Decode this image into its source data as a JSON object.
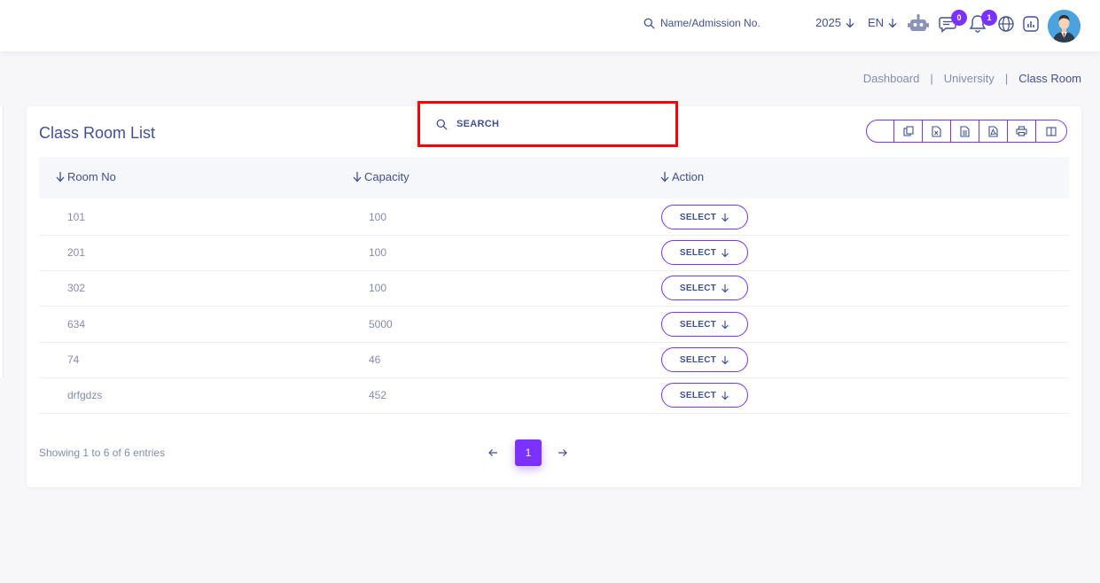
{
  "header": {
    "search_placeholder": "Name/Admission No.",
    "year": "2025",
    "language": "EN",
    "message_count": "0",
    "notification_count": "1"
  },
  "breadcrumb": {
    "items": [
      "Dashboard",
      "University",
      "Class Room"
    ]
  },
  "card": {
    "title": "Class Room List",
    "search_placeholder": "SEARCH",
    "export_buttons": [
      "copy-icon",
      "excel-icon",
      "csv-icon",
      "pdf-icon",
      "print-icon",
      "columns-icon"
    ]
  },
  "table": {
    "columns": [
      "Room No",
      "Capacity",
      "Action"
    ],
    "rows": [
      {
        "room": "101",
        "capacity": "100",
        "action": "SELECT"
      },
      {
        "room": "201",
        "capacity": "100",
        "action": "SELECT"
      },
      {
        "room": "302",
        "capacity": "100",
        "action": "SELECT"
      },
      {
        "room": "634",
        "capacity": "5000",
        "action": "SELECT"
      },
      {
        "room": "74",
        "capacity": "46",
        "action": "SELECT"
      },
      {
        "room": "drfgdzs",
        "capacity": "452",
        "action": "SELECT"
      }
    ]
  },
  "footer": {
    "info": "Showing 1 to 6 of 6 entries",
    "current_page": "1"
  },
  "colors": {
    "accent": "#7c32ff",
    "text": "#415094",
    "muted": "#828bb2",
    "highlight": "#ff0000"
  }
}
